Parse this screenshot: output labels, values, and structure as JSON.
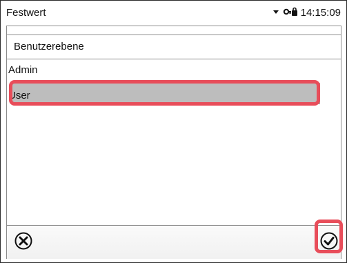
{
  "status_bar": {
    "title": "Festwert",
    "time": "14:15:09",
    "icons": [
      "dropdown-arrow-icon",
      "key-lock-icon"
    ]
  },
  "dialog": {
    "header": "Benutzerebene",
    "options": [
      "Admin",
      "User"
    ],
    "selected": "User"
  },
  "footer": {
    "cancel_icon": "cancel-circle-x-icon",
    "confirm_icon": "confirm-check-circle-icon"
  },
  "colors": {
    "highlight": "#e84d5a",
    "selected_row": "#bdbdbd",
    "border": "#8c8c8c"
  }
}
